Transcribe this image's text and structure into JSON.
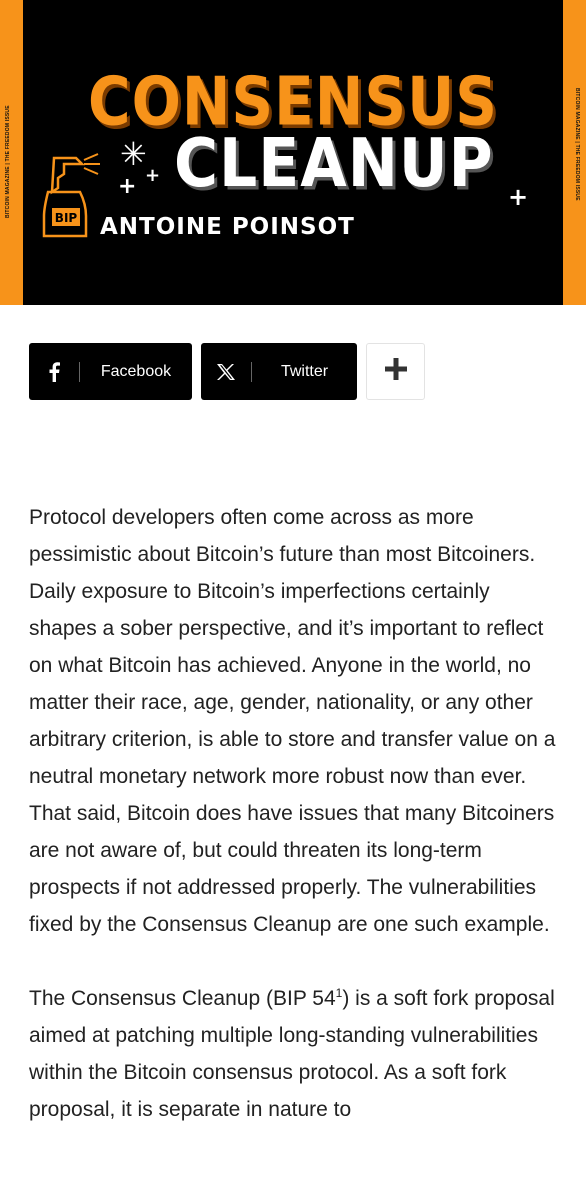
{
  "hero": {
    "side_text": "BITCOIN MAGAZINE | THE FREEDOM ISSUE",
    "title_line1": "CONSENSUS",
    "title_line2": "CLEANUP",
    "author": "ANTOINE POINSOT",
    "bottle_label": "BIP",
    "colors": {
      "accent": "#f7931a",
      "background": "#000000"
    }
  },
  "share": {
    "facebook_label": "Facebook",
    "twitter_label": "Twitter",
    "facebook_icon": "facebook-icon",
    "twitter_icon": "x-icon",
    "more_icon": "plus-icon"
  },
  "article": {
    "p1": "Protocol developers often come across as more pessimistic about Bitcoin’s future than most Bitcoiners. Daily exposure to Bitcoin’s imperfections certainly shapes a sober perspective, and it’s important to reflect on what Bitcoin has achieved. Anyone in the world, no matter their race, age, gender, nationality, or any other arbitrary criterion, is able to store and transfer value on a neutral monetary network more robust now than ever. That said, Bitcoin does have issues that many Bitcoiners are not aware of, but could threaten its long-term prospects if not addressed properly. The vulnerabilities fixed by the Consensus Cleanup are one such example.",
    "p2_before": "The Consensus Cleanup (BIP 54",
    "p2_sup": "1",
    "p2_after": ") is a soft fork proposal aimed at patching multiple long-standing vulnerabilities within the Bitcoin consensus protocol. As a soft fork proposal, it is separate in nature to"
  }
}
